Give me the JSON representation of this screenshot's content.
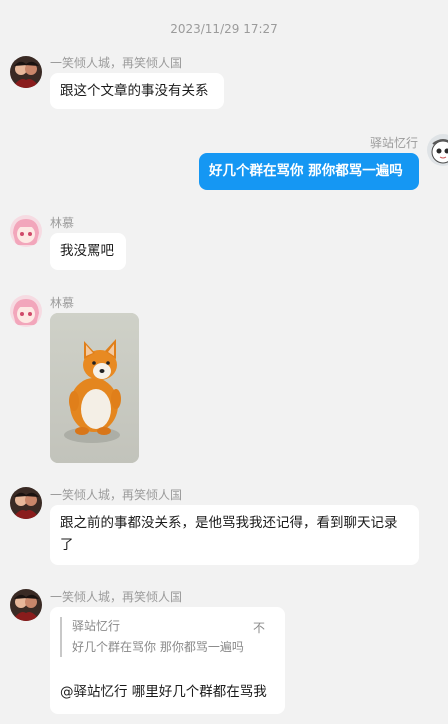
{
  "timestamp": "2023/11/29 17:27",
  "messages": [
    {
      "sender": "一笑倾人城，再笑倾人国",
      "text": "跟这个文章的事没有关系"
    },
    {
      "sender": "驿站忆行",
      "text": "好几个群在骂你 那你都骂一遍吗"
    },
    {
      "sender": "林慕",
      "text": "我没罵吧"
    },
    {
      "sender": "林慕",
      "image": "corgi-figurine-photo"
    },
    {
      "sender": "一笑倾人城，再笑倾人国",
      "text": "跟之前的事都没关系，是他骂我我还记得，看到聊天记录了"
    },
    {
      "sender": "一笑倾人城，再笑倾人国",
      "quote": {
        "name": "驿站忆行",
        "text": "好几个群在骂你 那你都骂一遍吗",
        "more": "不"
      },
      "text": "@驿站忆行 哪里好几个群都在骂我"
    }
  ],
  "colors": {
    "self_bubble": "#1597f3",
    "other_bubble": "#ffffff",
    "background": "#f2f2f2"
  }
}
